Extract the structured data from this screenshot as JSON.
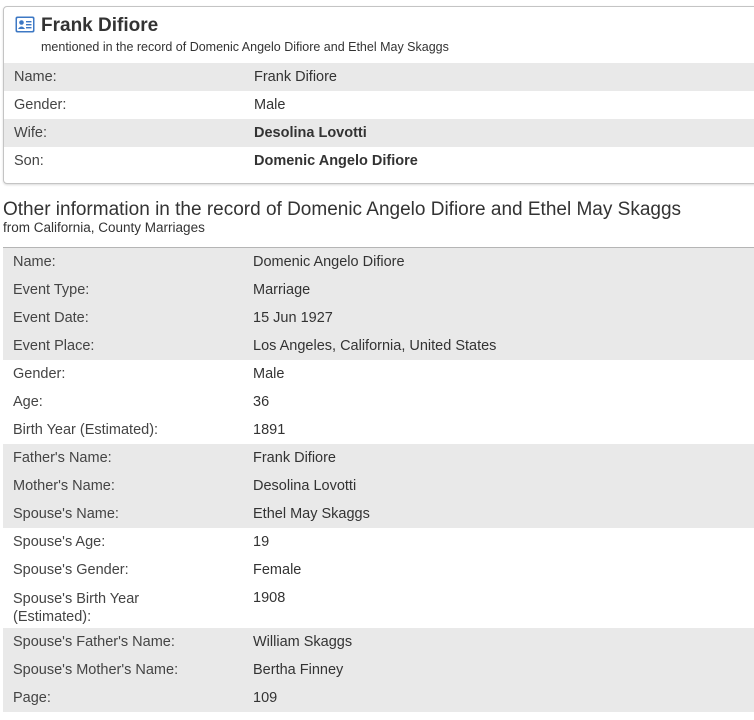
{
  "person": {
    "name": "Frank Difiore",
    "subtitle": "mentioned in the record of Domenic Angelo Difiore and Ethel May Skaggs",
    "icon": "person-card-icon",
    "fields": [
      {
        "label": "Name:",
        "value": "Frank Difiore",
        "style": "link"
      },
      {
        "label": "Gender:",
        "value": "Male",
        "style": "plain"
      },
      {
        "label": "Wife:",
        "value": "Desolina Lovotti",
        "style": "link-bold"
      },
      {
        "label": "Son:",
        "value": "Domenic Angelo Difiore",
        "style": "link-bold"
      }
    ]
  },
  "record": {
    "title": "Other information in the record of Domenic Angelo Difiore and Ethel May Skaggs",
    "source": "from California, County Marriages",
    "fields": [
      {
        "label": "Name:",
        "value": "Domenic Angelo Difiore",
        "style": "link"
      },
      {
        "label": "Event Type:",
        "value": "Marriage",
        "style": "plain"
      },
      {
        "label": "Event Date:",
        "value": "15 Jun 1927",
        "style": "plain"
      },
      {
        "label": "Event Place:",
        "value": "Los Angeles, California, United States",
        "style": "plain"
      },
      {
        "label": "Gender:",
        "value": "Male",
        "style": "plain"
      },
      {
        "label": "Age:",
        "value": "36",
        "style": "plain"
      },
      {
        "label": "Birth Year (Estimated):",
        "value": "1891",
        "style": "plain"
      },
      {
        "label": "Father's Name:",
        "value": "Frank Difiore",
        "style": "plain"
      },
      {
        "label": "Mother's Name:",
        "value": "Desolina Lovotti",
        "style": "link"
      },
      {
        "label": "Spouse's Name:",
        "value": "Ethel May Skaggs",
        "style": "link"
      },
      {
        "label": "Spouse's Age:",
        "value": "19",
        "style": "plain"
      },
      {
        "label": "Spouse's Gender:",
        "value": "Female",
        "style": "plain"
      },
      {
        "label": "Spouse's Birth Year (Estimated):",
        "value": "1908",
        "style": "plain"
      },
      {
        "label": "Spouse's Father's Name:",
        "value": "William Skaggs",
        "style": "link"
      },
      {
        "label": "Spouse's Mother's Name:",
        "value": "Bertha Finney",
        "style": "link"
      },
      {
        "label": "Page:",
        "value": "109",
        "style": "plain"
      }
    ]
  },
  "colors": {
    "link": "#1a5ea8",
    "row_shade": "#e9e9e9",
    "icon": "#3d78c4"
  }
}
